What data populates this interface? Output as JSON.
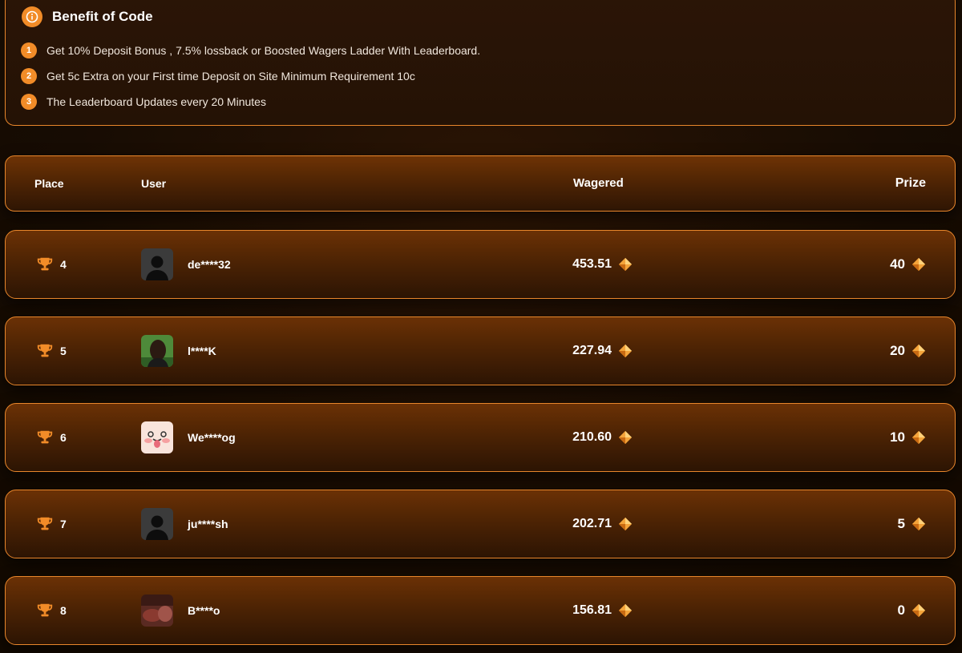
{
  "benefit": {
    "title": "Benefit of Code",
    "items": [
      {
        "num": "1",
        "text": "Get 10% Deposit Bonus , 7.5% lossback or Boosted Wagers Ladder With Leaderboard."
      },
      {
        "num": "2",
        "text": "Get 5c Extra on your First time Deposit on Site Minimum Requirement 10c"
      },
      {
        "num": "3",
        "text": "The Leaderboard Updates every 20 Minutes"
      }
    ]
  },
  "table": {
    "headers": {
      "place": "Place",
      "user": "User",
      "wagered": "Wagered",
      "prize": "Prize"
    },
    "rows": [
      {
        "place": "4",
        "user": "de****32",
        "avatar": "default-avatar",
        "wagered": "453.51",
        "prize": "40"
      },
      {
        "place": "5",
        "user": "l****K",
        "avatar": "photo-avatar",
        "wagered": "227.94",
        "prize": "20"
      },
      {
        "place": "6",
        "user": "We****og",
        "avatar": "cartoon-avatar",
        "wagered": "210.60",
        "prize": "10"
      },
      {
        "place": "7",
        "user": "ju****sh",
        "avatar": "default-avatar",
        "wagered": "202.71",
        "prize": "5"
      },
      {
        "place": "8",
        "user": "B****o",
        "avatar": "photo-avatar",
        "wagered": "156.81",
        "prize": "0"
      }
    ]
  },
  "colors": {
    "accent": "#f28c28",
    "border": "#e8862b",
    "row_top": "#6b3105",
    "row_bottom": "#2c1403"
  }
}
